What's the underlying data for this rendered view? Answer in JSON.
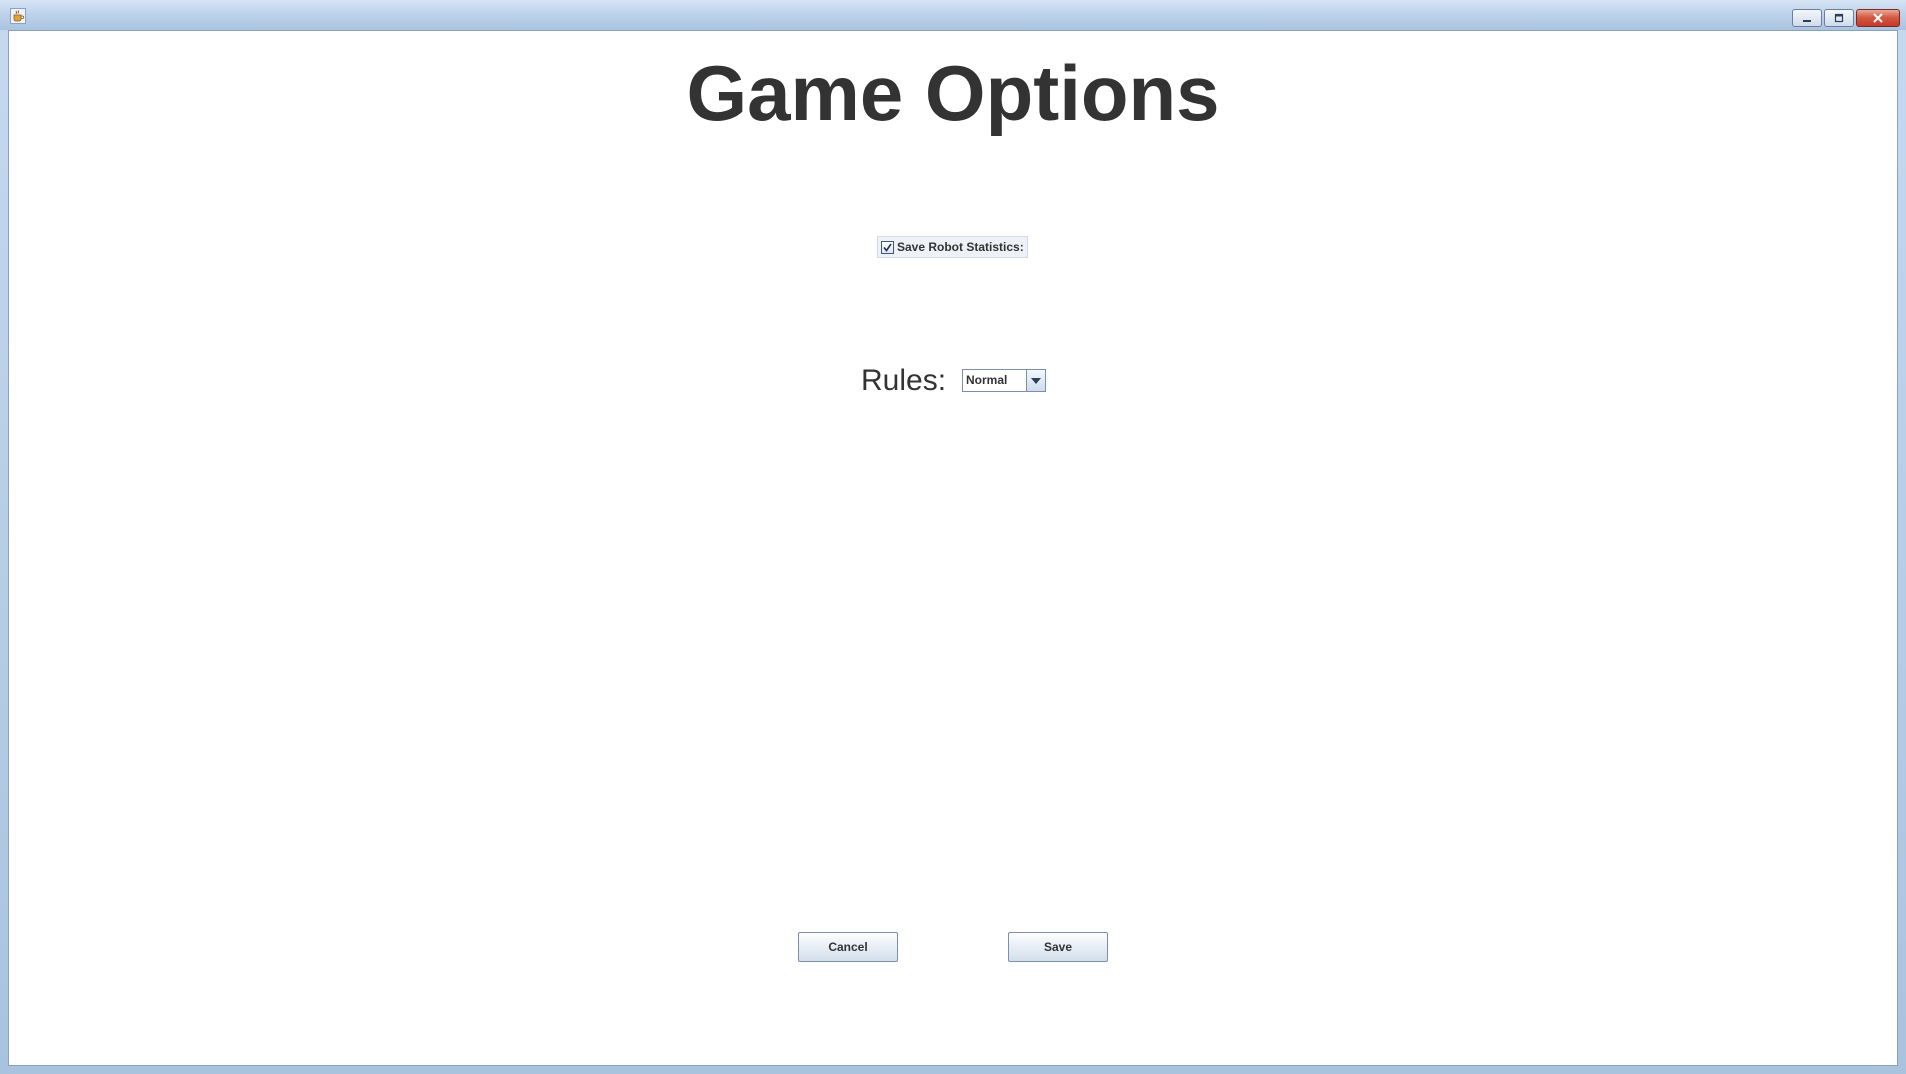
{
  "window": {
    "title": "",
    "controls": {
      "minimize_icon": "minimize-icon",
      "maximize_icon": "maximize-icon",
      "close_icon": "close-icon"
    },
    "app_icon": "java-cup-icon"
  },
  "page": {
    "title": "Game Options"
  },
  "options": {
    "save_robot_statistics": {
      "label": "Save Robot Statistics:",
      "checked": true
    },
    "rules": {
      "label": "Rules:",
      "selected": "Normal"
    }
  },
  "actions": {
    "cancel_label": "Cancel",
    "save_label": "Save"
  },
  "colors": {
    "text": "#333333",
    "background": "#ffffff",
    "titlebar": "#bcd1ea",
    "close_button": "#c2392a"
  }
}
